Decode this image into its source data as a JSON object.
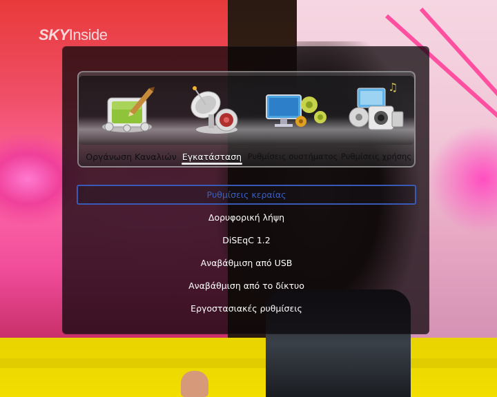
{
  "background": {
    "logo_text_bold": "SKY",
    "logo_text_rest": "Inside"
  },
  "tabs": [
    {
      "label": "Οργάνωση Καναλιών",
      "icon": "tv-pencil-icon",
      "active": false
    },
    {
      "label": "Εγκατάσταση",
      "icon": "satellite-dish-icon",
      "active": true
    },
    {
      "label": "Ρυθμίσεις συστήματος",
      "icon": "monitor-gears-icon",
      "active": false
    },
    {
      "label": "Ρυθμίσεις χρήσης",
      "icon": "media-devices-icon",
      "active": false
    }
  ],
  "menu": {
    "items": [
      {
        "label": "Ρυθμίσεις κεραίας",
        "selected": true
      },
      {
        "label": "Δορυφορική λήψη",
        "selected": false
      },
      {
        "label": "DiSEqC 1.2",
        "selected": false
      },
      {
        "label": "Αναβάθμιση από USB",
        "selected": false
      },
      {
        "label": "Αναβάθμιση από το δίκτυο",
        "selected": false
      },
      {
        "label": "Εργοστασιακές ρυθμίσεις",
        "selected": false
      }
    ]
  },
  "colors": {
    "selection_border": "#3a5ab8",
    "selected_text": "#3d5fbf",
    "panel_bg": "rgba(10,6,8,0.74)"
  }
}
